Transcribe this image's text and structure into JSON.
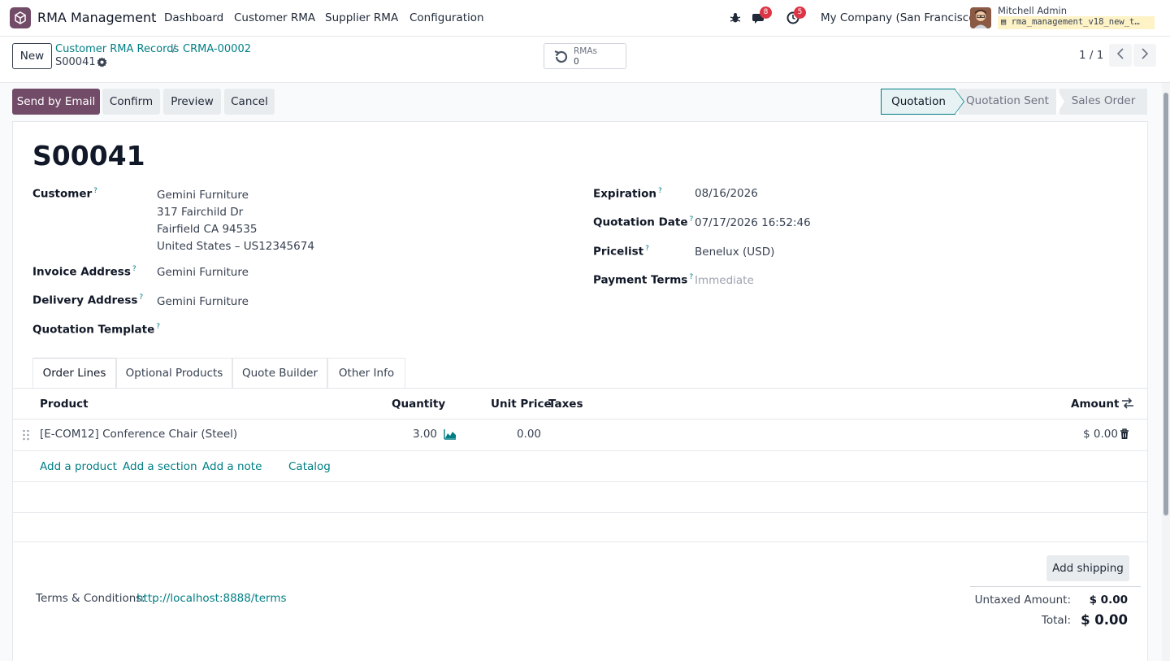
{
  "navbar": {
    "app_name": "RMA Management",
    "menu": [
      "Dashboard",
      "Customer RMA",
      "Supplier RMA",
      "Configuration"
    ],
    "messages_count": "8",
    "activities_count": "5",
    "company": "My Company (San Francisco)",
    "user_name": "Mitchell Admin",
    "database": "rma_management_v18_new_t…"
  },
  "control_panel": {
    "new_label": "New",
    "breadcrumb": [
      "Customer RMA Records",
      "CRMA-00002"
    ],
    "breadcrumb_sep": "/",
    "record_name": "S00041",
    "smart_button": {
      "label": "RMAs",
      "value": "0"
    },
    "pager": "1 / 1"
  },
  "actions": {
    "send_email": "Send by Email",
    "confirm": "Confirm",
    "preview": "Preview",
    "cancel": "Cancel"
  },
  "statusbar": {
    "stages": [
      "Quotation",
      "Quotation Sent",
      "Sales Order"
    ],
    "active": "Quotation"
  },
  "form": {
    "title": "S00041",
    "left_fields": {
      "customer_label": "Customer",
      "customer_lines": [
        "Gemini Furniture",
        "317 Fairchild Dr",
        "Fairfield CA 94535",
        "United States – US12345674"
      ],
      "invoice_label": "Invoice Address",
      "invoice_value": "Gemini Furniture",
      "delivery_label": "Delivery Address",
      "delivery_value": "Gemini Furniture",
      "template_label": "Quotation Template"
    },
    "right_fields": {
      "expiration_label": "Expiration",
      "expiration_value": "08/16/2026",
      "date_label": "Quotation Date",
      "date_value": "07/17/2026 16:52:46",
      "pricelist_label": "Pricelist",
      "pricelist_value": "Benelux (USD)",
      "terms_label": "Payment Terms",
      "terms_placeholder": "Immediate"
    },
    "help_mark": "?"
  },
  "tabs": [
    "Order Lines",
    "Optional Products",
    "Quote Builder",
    "Other Info"
  ],
  "order_lines": {
    "columns": {
      "product": "Product",
      "quantity": "Quantity",
      "unit_price": "Unit Price",
      "taxes": "Taxes",
      "amount": "Amount"
    },
    "rows": [
      {
        "product": "[E-COM12] Conference Chair (Steel)",
        "quantity": "3.00",
        "unit_price": "0.00",
        "taxes": "",
        "amount": "$ 0.00"
      }
    ],
    "add_links": [
      "Add a product",
      "Add a section",
      "Add a note",
      "Catalog"
    ]
  },
  "footer": {
    "terms_label": "Terms & Conditions:",
    "terms_link": "http://localhost:8888/terms",
    "add_shipping": "Add shipping",
    "untaxed_label": "Untaxed Amount:",
    "untaxed_value": "$ 0.00",
    "total_label": "Total:",
    "total_value": "$ 0.00"
  },
  "colors": {
    "brand": "#714b67",
    "link": "#017e84",
    "badge": "#dc3545"
  }
}
